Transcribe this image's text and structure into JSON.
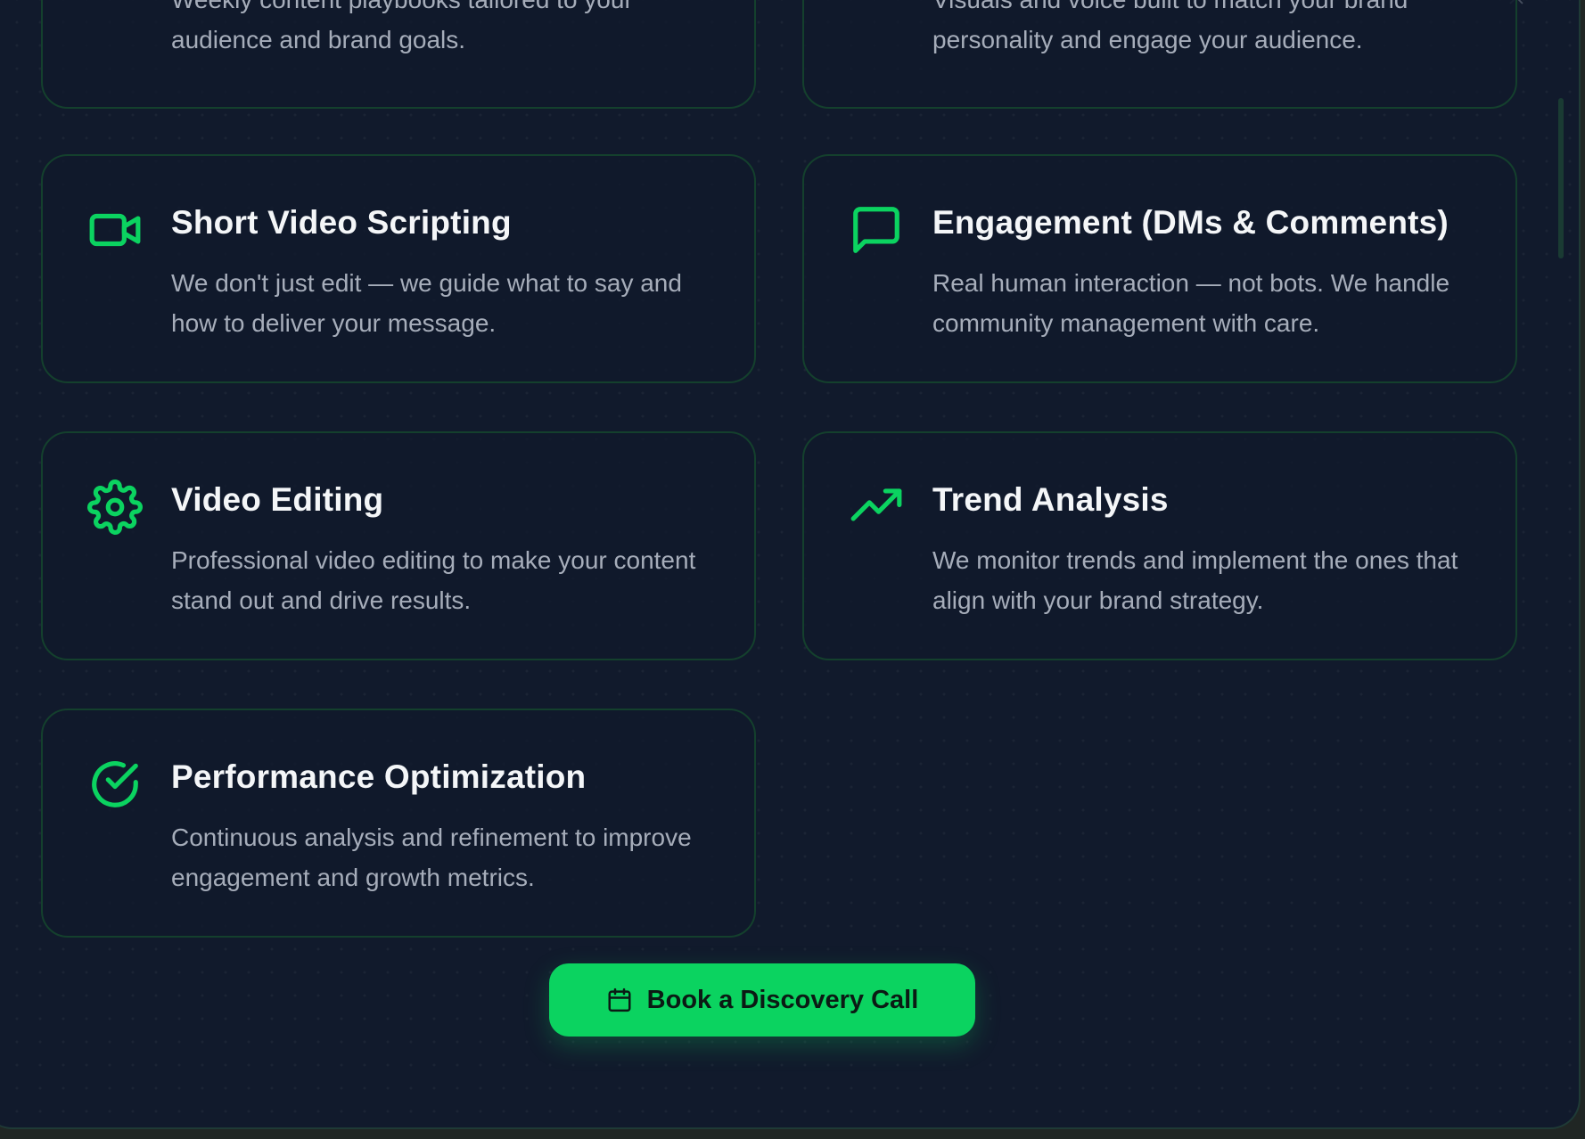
{
  "colors": {
    "accent": "#0bd360",
    "background": "#111a2c",
    "card_border": "#14402d",
    "title": "#f4f6f8",
    "description": "#a6adba"
  },
  "cards_top": [
    {
      "description": "Weekly content playbooks tailored to your audience and brand goals."
    },
    {
      "description": "Visuals and voice built to match your brand personality and engage your audience."
    }
  ],
  "services": [
    {
      "icon": "video-camera-icon",
      "title": "Short Video Scripting",
      "description": "We don't just edit — we guide what to say and how to deliver your message."
    },
    {
      "icon": "chat-bubble-icon",
      "title": "Engagement (DMs & Comments)",
      "description": "Real human interaction — not bots. We handle community management with care."
    },
    {
      "icon": "gear-icon",
      "title": "Video Editing",
      "description": "Professional video editing to make your content stand out and drive results."
    },
    {
      "icon": "trending-up-icon",
      "title": "Trend Analysis",
      "description": "We monitor trends and implement the ones that align with your brand strategy."
    },
    {
      "icon": "check-circle-icon",
      "title": "Performance Optimization",
      "description": "Continuous analysis and refinement to improve engagement and growth metrics."
    }
  ],
  "cta": {
    "icon": "calendar-icon",
    "label": "Book a Discovery Call"
  },
  "close_icon": "close-icon"
}
